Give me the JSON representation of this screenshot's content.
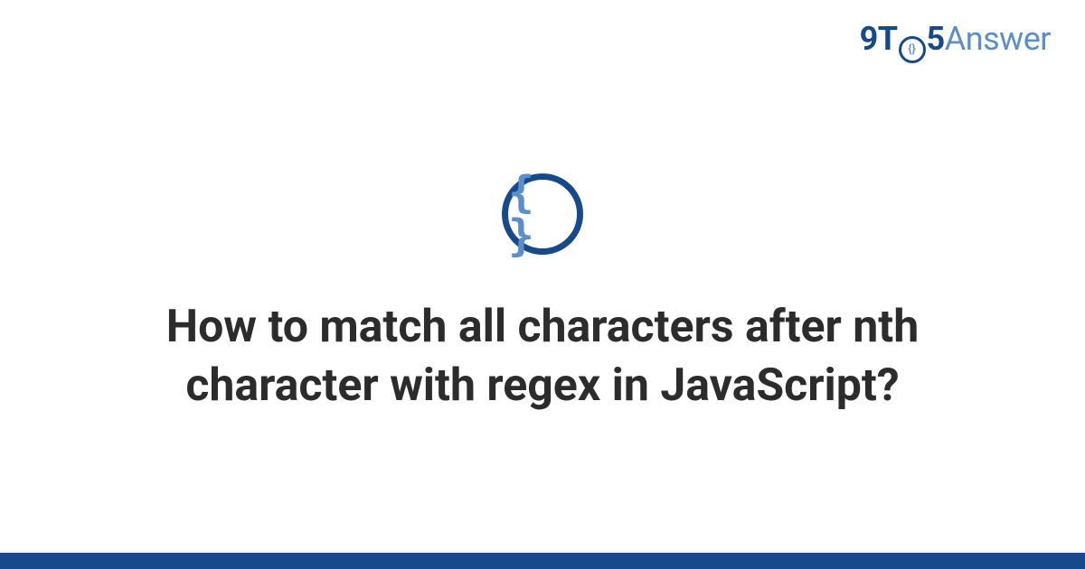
{
  "logo": {
    "part1": "9T",
    "clock_inner": "{}",
    "part2": "5",
    "part3": "Answer"
  },
  "icon": {
    "symbol": "{ }"
  },
  "title": "How to match all characters after nth character with regex in JavaScript?",
  "colors": {
    "primary": "#174a8a",
    "secondary": "#5b8fc9",
    "text": "#2c2c2c"
  }
}
